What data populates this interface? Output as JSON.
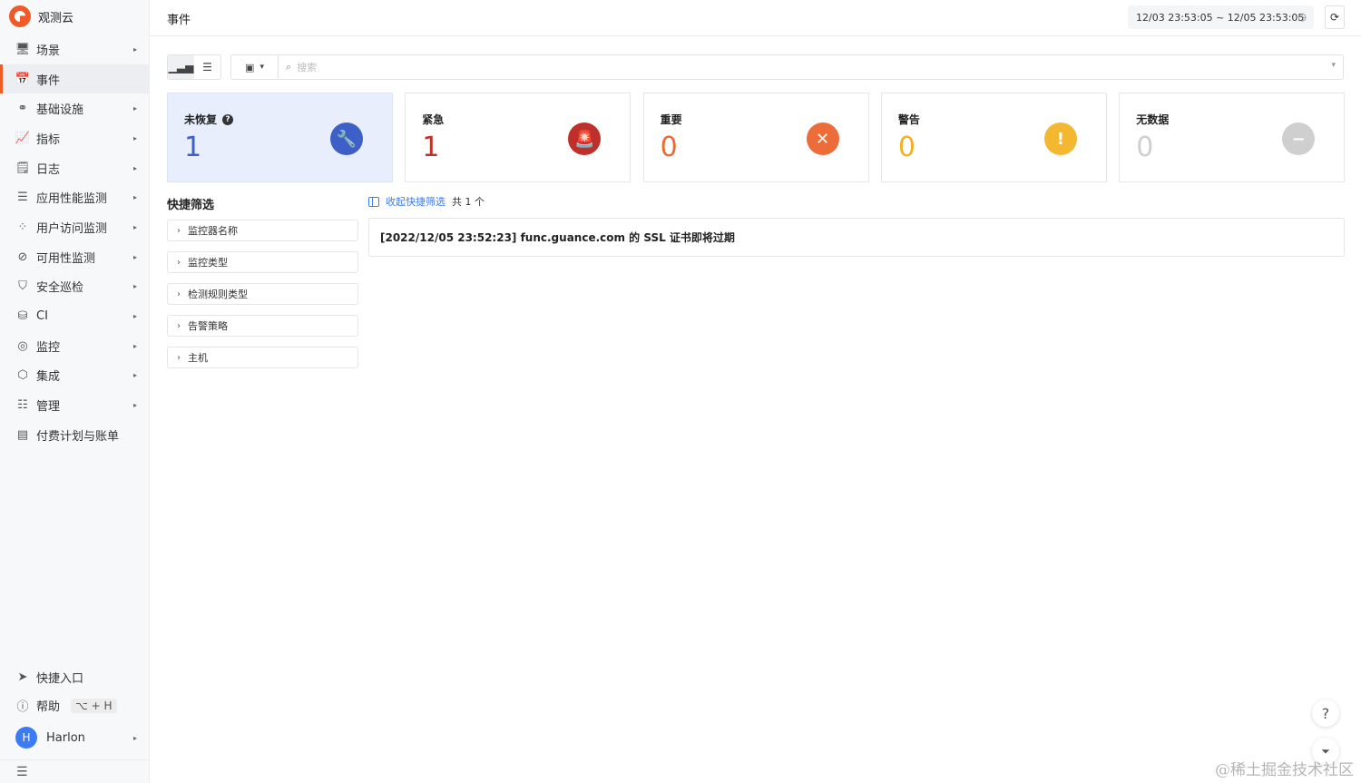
{
  "app": {
    "name": "观测云"
  },
  "sidebar": {
    "items": [
      {
        "label": "场景",
        "icon": "monitor-icon",
        "glyph": "🖥",
        "has_submenu": true
      },
      {
        "label": "事件",
        "icon": "calendar-icon",
        "glyph": "📅",
        "active": true,
        "has_submenu": false
      },
      {
        "label": "基础设施",
        "icon": "nodes-icon",
        "glyph": "⚭",
        "has_submenu": true
      },
      {
        "label": "指标",
        "icon": "chart-icon",
        "glyph": "📈",
        "has_submenu": true
      },
      {
        "label": "日志",
        "icon": "log-search-icon",
        "glyph": "🗒",
        "has_submenu": true
      },
      {
        "label": "应用性能监测",
        "icon": "filter-lines-icon",
        "glyph": "☰",
        "has_submenu": true
      },
      {
        "label": "用户访问监测",
        "icon": "grid-circles-icon",
        "glyph": "⁘",
        "has_submenu": true
      },
      {
        "label": "可用性监测",
        "icon": "availability-icon",
        "glyph": "⊘",
        "has_submenu": true
      },
      {
        "label": "安全巡检",
        "icon": "shield-icon",
        "glyph": "⛉",
        "has_submenu": true
      },
      {
        "label": "CI",
        "icon": "database-icon",
        "glyph": "⛁",
        "has_submenu": true
      },
      {
        "label": "监控",
        "icon": "monitor-target-icon",
        "glyph": "◎",
        "has_submenu": true
      },
      {
        "label": "集成",
        "icon": "cube-icon",
        "glyph": "⬡",
        "has_submenu": true
      },
      {
        "label": "管理",
        "icon": "sliders-icon",
        "glyph": "☷",
        "has_submenu": true
      },
      {
        "label": "付费计划与账单",
        "icon": "bill-icon",
        "glyph": "▤",
        "has_submenu": false
      }
    ],
    "caret": "▸",
    "quick_entry": "快捷入口",
    "help": "帮助",
    "help_shortcut": "⌥ + H",
    "user_initial": "H",
    "user_name": "Harlon"
  },
  "header": {
    "title": "事件",
    "time_range": "12/03 23:53:05 ~ 12/05 23:53:05"
  },
  "search": {
    "placeholder": "搜索"
  },
  "cards": [
    {
      "label": "未恢复",
      "value": "1",
      "icon": "wrench-icon",
      "glyph": "🔧",
      "color": "#3d5fc7",
      "icon_bg": "#3d5fc7",
      "selected": true,
      "help": true
    },
    {
      "label": "紧急",
      "value": "1",
      "icon": "alarm-icon",
      "glyph": "🚨",
      "color": "#c0302b",
      "icon_bg": "#c0302b"
    },
    {
      "label": "重要",
      "value": "0",
      "icon": "close-circle-icon",
      "glyph": "✕",
      "color": "#e86d34",
      "icon_bg": "#ec6d3a"
    },
    {
      "label": "警告",
      "value": "0",
      "icon": "exclamation-icon",
      "glyph": "!",
      "color": "#f2b125",
      "icon_bg": "#f4b730"
    },
    {
      "label": "无数据",
      "value": "0",
      "icon": "minus-circle-icon",
      "glyph": "−",
      "color": "#cfcfcf",
      "icon_bg": "#cfcfcf"
    }
  ],
  "quick_filter": {
    "title": "快捷筛选",
    "items": [
      "监控器名称",
      "监控类型",
      "检测规则类型",
      "告警策略",
      "主机"
    ],
    "collapse_label": "收起快捷筛选",
    "count_label": "共 1 个"
  },
  "events": [
    {
      "text": "[2022/12/05 23:52:23] func.guance.com 的 SSL 证书即将过期"
    }
  ],
  "float": {
    "help_glyph": "?",
    "filter_glyph": "⏷"
  },
  "watermark": "@稀土掘金技术社区",
  "colors": {
    "accent": "#f05a28",
    "link": "#3d7bf2"
  }
}
